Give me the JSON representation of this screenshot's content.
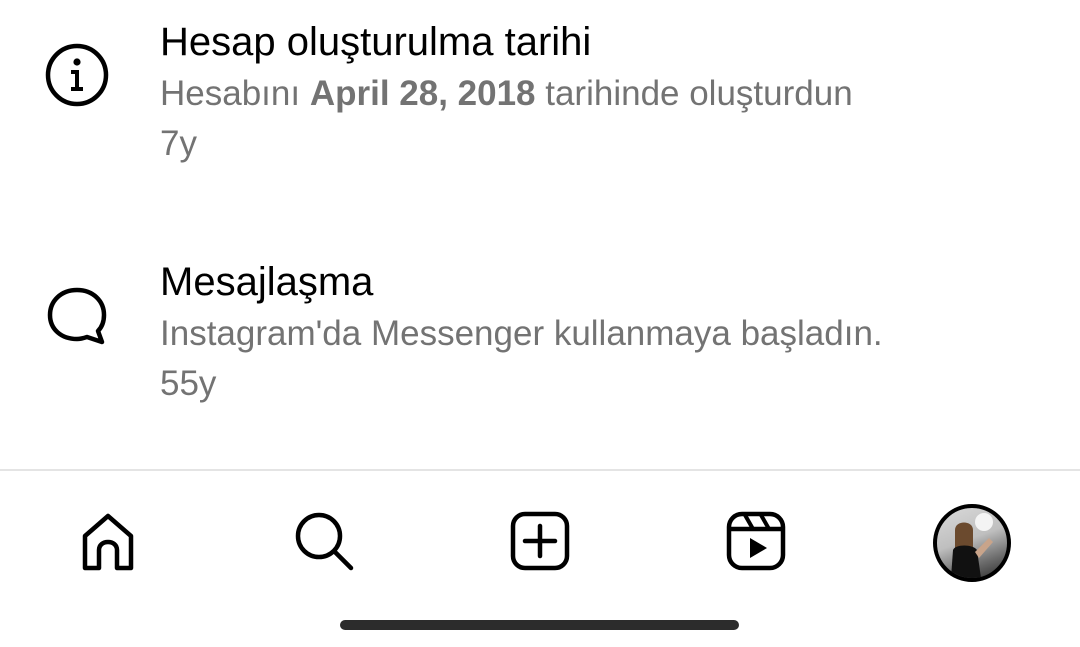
{
  "items": [
    {
      "icon": "info-icon",
      "title": "Hesap oluşturulma tarihi",
      "desc_prefix": "Hesabını ",
      "desc_date": "April 28, 2018",
      "desc_suffix": " tarihinde oluşturdun",
      "time": "7y"
    },
    {
      "icon": "message-bubble-icon",
      "title": "Mesajlaşma",
      "desc": "Instagram'da Messenger kullanmaya başladın.",
      "time": "55y"
    }
  ],
  "bottom_nav": [
    {
      "icon": "home-icon"
    },
    {
      "icon": "search-icon"
    },
    {
      "icon": "create-post-icon"
    },
    {
      "icon": "reels-icon"
    },
    {
      "icon": "profile-avatar"
    }
  ]
}
